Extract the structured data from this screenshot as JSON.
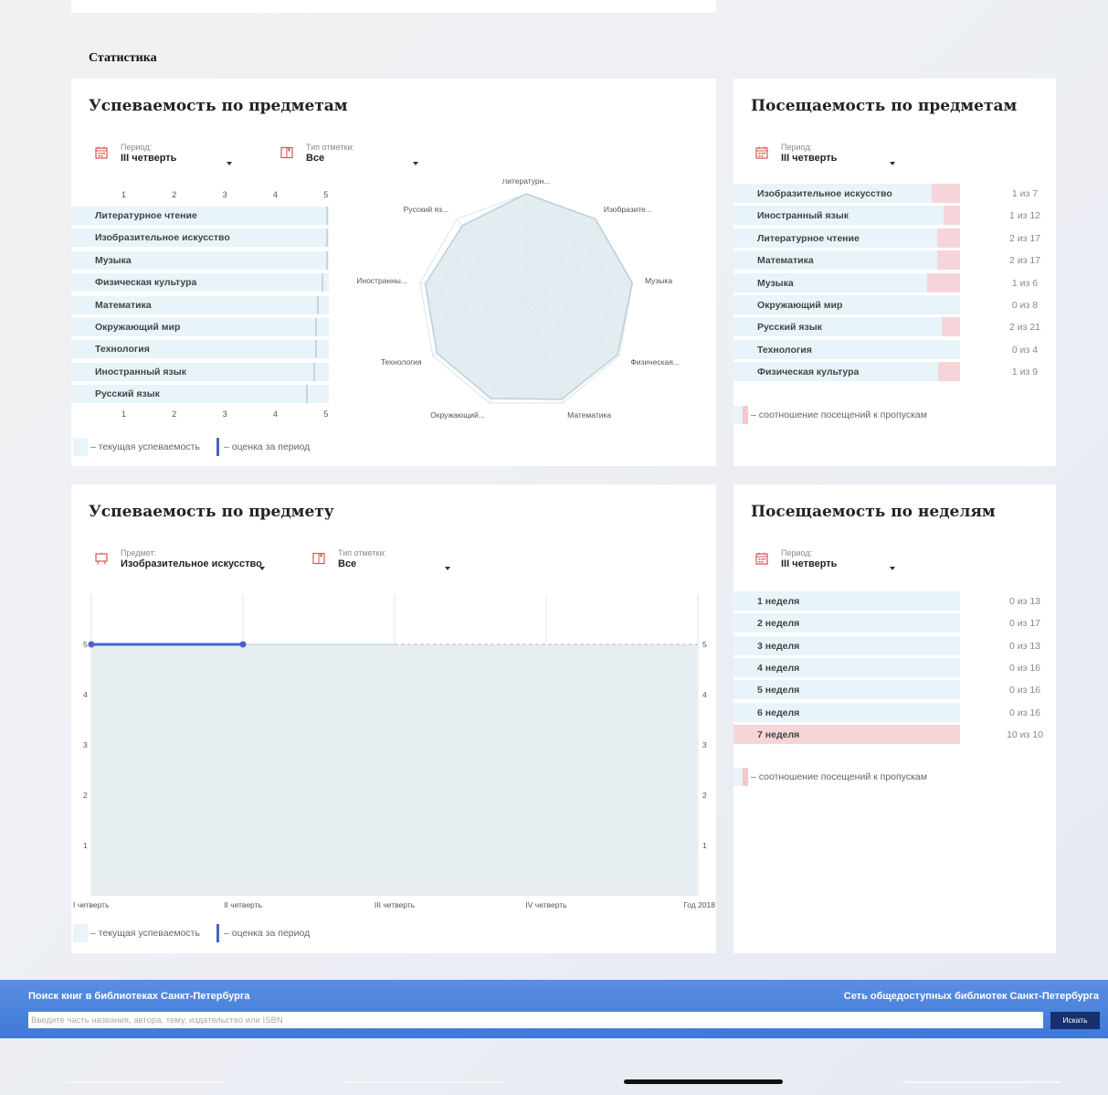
{
  "section_title": "Статистика",
  "cards": {
    "performance_by_subjects": {
      "title": "Успеваемость по предметам",
      "period_label": "Период:",
      "period_value": "III четверть",
      "mark_type_label": "Тип отметки:",
      "mark_type_value": "Все",
      "axis_ticks": [
        "1",
        "2",
        "3",
        "4",
        "5"
      ],
      "subjects": [
        {
          "name": "Литературное чтение",
          "value": 5.0
        },
        {
          "name": "Изобразительное искусство",
          "value": 5.0
        },
        {
          "name": "Музыка",
          "value": 5.0
        },
        {
          "name": "Физическая культура",
          "value": 4.9
        },
        {
          "name": "Математика",
          "value": 4.82
        },
        {
          "name": "Окружающий мир",
          "value": 4.78
        },
        {
          "name": "Технология",
          "value": 4.78
        },
        {
          "name": "Иностранный язык",
          "value": 4.75
        },
        {
          "name": "Русский язык",
          "value": 4.6
        }
      ],
      "radar_labels": [
        "Литературн...",
        "Изобразите...",
        "Музыка",
        "Физическая...",
        "Математика",
        "Окружающий...",
        "Технология",
        "Иностранны...",
        "Русский яз..."
      ],
      "legend_current": "– текущая успеваемость",
      "legend_period": "– оценка за период"
    },
    "attendance_by_subjects": {
      "title": "Посещаемость по предметам",
      "period_label": "Период:",
      "period_value": "III четверть",
      "rows": [
        {
          "name": "Изобразительное искусство",
          "count": "1 из 7",
          "ratio": 0.143
        },
        {
          "name": "Иностранный язык",
          "count": "1 из 12",
          "ratio": 0.083
        },
        {
          "name": "Литературное чтение",
          "count": "2 из 17",
          "ratio": 0.118
        },
        {
          "name": "Математика",
          "count": "2 из 17",
          "ratio": 0.118
        },
        {
          "name": "Музыка",
          "count": "1 из 6",
          "ratio": 0.167
        },
        {
          "name": "Окружающий мир",
          "count": "0 из 8",
          "ratio": 0
        },
        {
          "name": "Русский язык",
          "count": "2 из 21",
          "ratio": 0.095
        },
        {
          "name": "Технология",
          "count": "0 из 4",
          "ratio": 0
        },
        {
          "name": "Физическая культура",
          "count": "1 из 9",
          "ratio": 0.111
        }
      ],
      "legend": "– соотношение посещений к пропускам"
    },
    "performance_by_subject": {
      "title": "Успеваемость по предмету",
      "subject_label": "Предмет:",
      "subject_value": "Изобразительное искусство",
      "mark_type_label": "Тип отметки:",
      "mark_type_value": "Все",
      "legend_current": "– текущая успеваемость",
      "legend_period": "– оценка за период"
    },
    "attendance_by_weeks": {
      "title": "Посещаемость по неделям",
      "period_label": "Период:",
      "period_value": "III четверть",
      "rows": [
        {
          "name": "1 неделя",
          "count": "0 из 13",
          "ratio": 0,
          "highlight": false
        },
        {
          "name": "2 неделя",
          "count": "0 из 17",
          "ratio": 0,
          "highlight": false
        },
        {
          "name": "3 неделя",
          "count": "0 из 13",
          "ratio": 0,
          "highlight": false
        },
        {
          "name": "4 неделя",
          "count": "0 из 16",
          "ratio": 0,
          "highlight": false
        },
        {
          "name": "5 неделя",
          "count": "0 из 16",
          "ratio": 0,
          "highlight": false
        },
        {
          "name": "6 неделя",
          "count": "0 из 16",
          "ratio": 0,
          "highlight": false
        },
        {
          "name": "7 неделя",
          "count": "10 из 10",
          "ratio": 1,
          "highlight": true
        }
      ],
      "legend": "– соотношение посещений к пропускам"
    }
  },
  "chart_data": [
    {
      "type": "bar",
      "categories": [
        "Литературное чтение",
        "Изобразительное искусство",
        "Музыка",
        "Физическая культура",
        "Математика",
        "Окружающий мир",
        "Технология",
        "Иностранный язык",
        "Русский язык"
      ],
      "values": [
        5.0,
        5.0,
        5.0,
        4.9,
        4.82,
        4.78,
        4.78,
        4.75,
        4.6
      ],
      "xlim": [
        1,
        5
      ],
      "orientation": "horizontal"
    },
    {
      "type": "radar",
      "categories": [
        "Литературн...",
        "Изобразите...",
        "Музыка",
        "Физическая...",
        "Математика",
        "Окружающий...",
        "Технология",
        "Иностранны...",
        "Русский яз..."
      ],
      "values": [
        5.0,
        5.0,
        5.0,
        4.9,
        4.82,
        4.78,
        4.78,
        4.75,
        4.6
      ],
      "rlim": [
        0,
        5
      ]
    },
    {
      "type": "area",
      "categories": [
        "I четверть",
        "II четверть",
        "III четверть",
        "IV четверть",
        "Год 2018"
      ],
      "y_ticks": [
        "1",
        "2",
        "3",
        "4",
        "5"
      ],
      "ylim": [
        0,
        5
      ],
      "series": [
        {
          "values": [
            5,
            5,
            5,
            null,
            null
          ]
        },
        {
          "values": [
            5,
            5,
            null,
            null,
            null
          ]
        }
      ],
      "projection": [
        5,
        5
      ]
    }
  ],
  "footer": {
    "left_title": "Поиск книг в библиотеках Санкт-Петербурга",
    "right_title": "Сеть общедоступных библиотек Санкт-Петербурга",
    "search_placeholder": "Введите часть названия, автора, тему, издательство или ISBN",
    "search_button": "Искать"
  },
  "colors": {
    "bar_fill": "#e8f4f9",
    "pink": "#f6d5da",
    "accent_blue": "#4a63c9",
    "footer_blue": "#4680dc",
    "icon_red": "#d9534f"
  }
}
